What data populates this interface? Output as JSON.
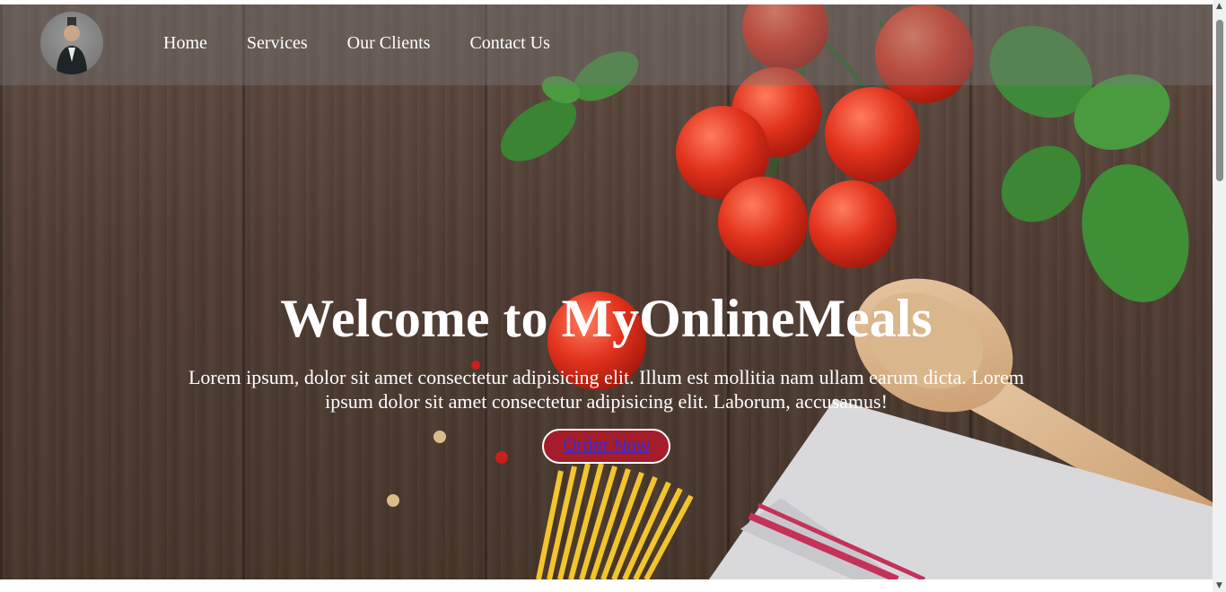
{
  "nav": {
    "links": [
      {
        "label": "Home"
      },
      {
        "label": "Services"
      },
      {
        "label": "Our Clients"
      },
      {
        "label": "Contact Us"
      }
    ]
  },
  "hero": {
    "headline": "Welcome to MyOnlineMeals",
    "tagline": "Lorem ipsum, dolor sit amet consectetur adipisicing elit. Illum est mollitia nam ullam earum dicta. Lorem ipsum dolor sit amet consectetur adipisicing elit. Laborum, accusamus!",
    "cta_label": "Order Now"
  },
  "scrollbar": {
    "up_icon": "triangle-up",
    "down_icon": "triangle-down"
  },
  "colors": {
    "cta_background": "#a51d2a",
    "cta_text": "#3d2bc9",
    "nav_overlay": "rgba(120,120,120,0.40)"
  }
}
